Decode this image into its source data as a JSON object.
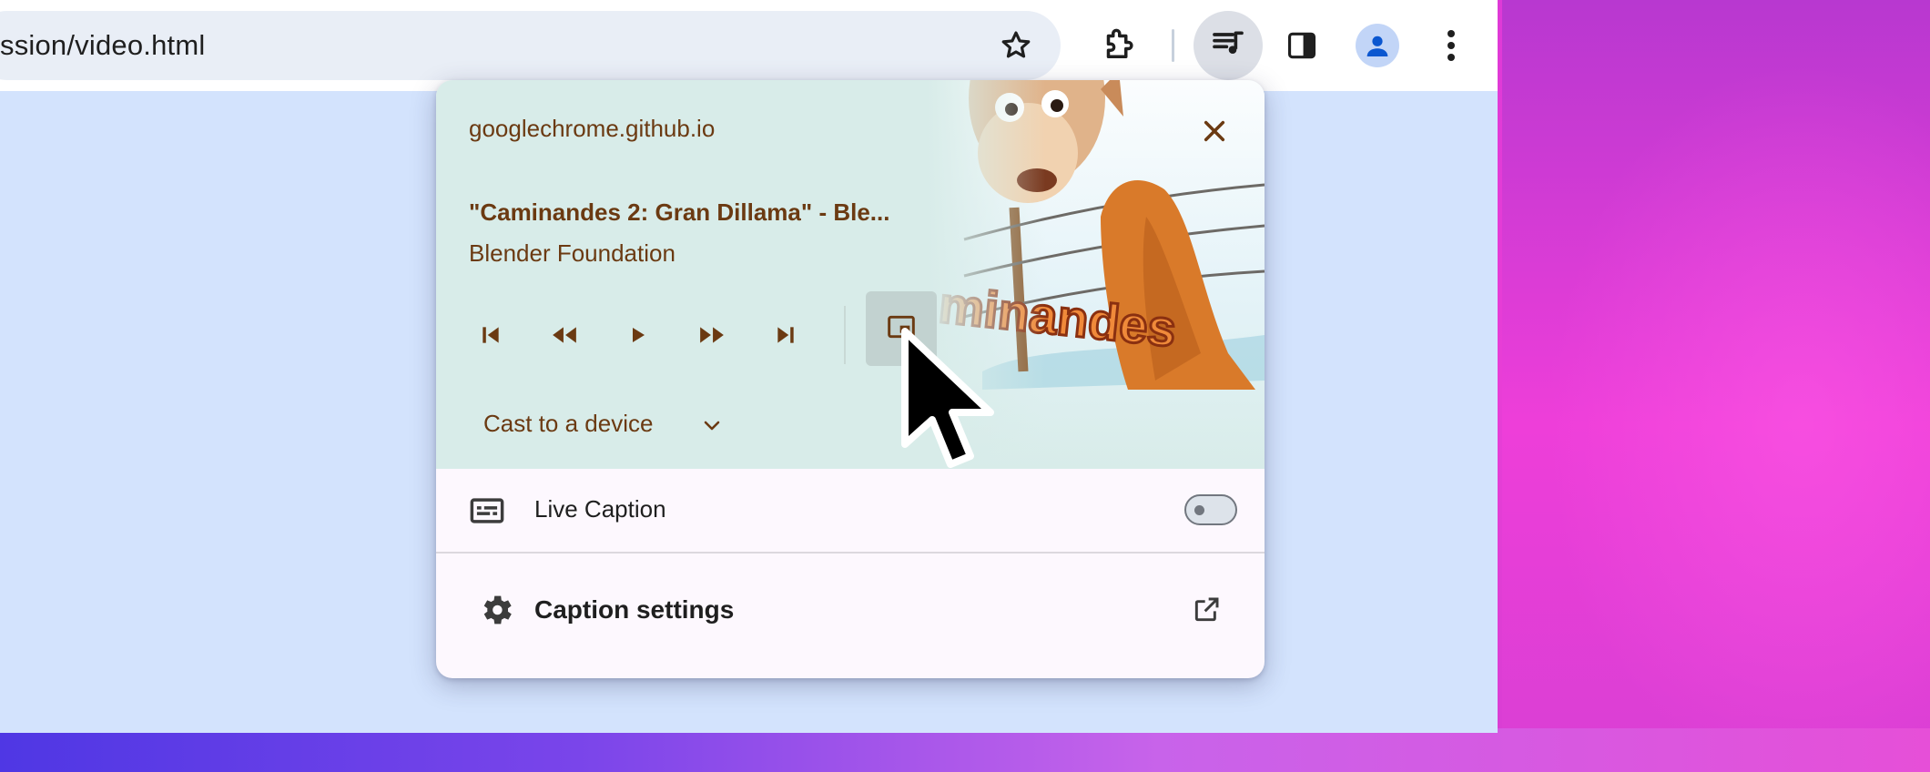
{
  "browser": {
    "url_fragment": "ssion/video.html",
    "icons": [
      "star-icon",
      "extensions-icon",
      "media-controls-icon",
      "side-panel-icon",
      "profile-avatar-icon",
      "more-vert-icon"
    ]
  },
  "media_popup": {
    "origin": "googlechrome.github.io",
    "title": "\"Caminandes 2: Gran Dillama\" - Ble...",
    "artist": "Blender Foundation",
    "artwork_text": "minandes",
    "controls": [
      "previous-track",
      "seek-backward",
      "play",
      "seek-forward",
      "next-track",
      "picture-in-picture"
    ],
    "cast_label": "Cast to a device"
  },
  "live_caption": {
    "label": "Live Caption",
    "enabled": false
  },
  "caption_settings": {
    "label": "Caption settings"
  },
  "colors": {
    "media_bg": "#d8ece9",
    "media_text": "#6b3a12",
    "page_bg": "#d3e3fd",
    "desktop_magenta": "#e83ed6"
  }
}
